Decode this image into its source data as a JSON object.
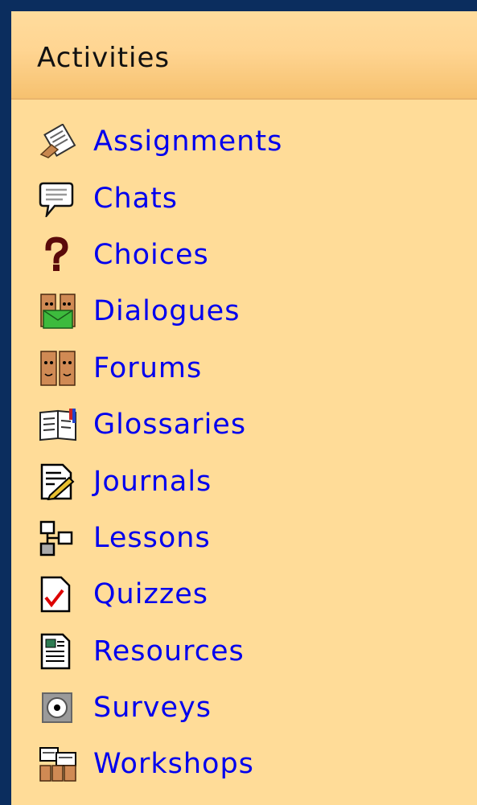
{
  "block": {
    "title": "Activities",
    "items": [
      {
        "label": "Assignments",
        "icon": "assignment-icon"
      },
      {
        "label": "Chats",
        "icon": "chat-icon"
      },
      {
        "label": "Choices",
        "icon": "question-icon"
      },
      {
        "label": "Dialogues",
        "icon": "dialogue-icon"
      },
      {
        "label": "Forums",
        "icon": "forum-icon"
      },
      {
        "label": "Glossaries",
        "icon": "glossary-icon"
      },
      {
        "label": "Journals",
        "icon": "journal-icon"
      },
      {
        "label": "Lessons",
        "icon": "lesson-icon"
      },
      {
        "label": "Quizzes",
        "icon": "quiz-icon"
      },
      {
        "label": "Resources",
        "icon": "resource-icon"
      },
      {
        "label": "Surveys",
        "icon": "survey-icon"
      },
      {
        "label": "Workshops",
        "icon": "workshop-icon"
      }
    ]
  },
  "colors": {
    "frame": "#0b2d5e",
    "block_bg": "#ffdc98",
    "link": "#0000ee"
  }
}
